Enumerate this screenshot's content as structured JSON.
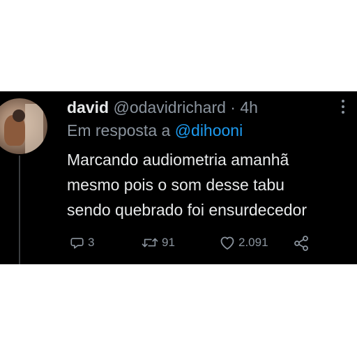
{
  "tweet": {
    "display_name": "david",
    "handle": "@odavidrichard",
    "separator": "·",
    "time": "4h",
    "reply_prefix": "Em resposta a",
    "reply_to": "@dihooni",
    "body_lines": [
      "Marcando audiometria amanhã",
      "mesmo pois o som desse tabu",
      "sendo quebrado foi ensurdecedor"
    ],
    "actions": {
      "replies": "3",
      "retweets": "91",
      "likes": "2.091"
    }
  },
  "colors": {
    "background": "#000000",
    "text": "#e7e9ea",
    "muted": "#8b949e",
    "mention": "#1d9bf0"
  },
  "icons": [
    "more-icon",
    "reply-icon",
    "retweet-icon",
    "like-icon",
    "share-icon"
  ]
}
